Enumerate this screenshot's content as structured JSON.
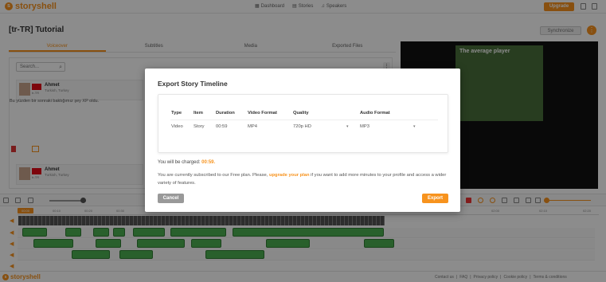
{
  "app": {
    "brand": "storyshell"
  },
  "nav": {
    "dashboard": "Dashboard",
    "stories": "Stories",
    "speakers": "Speakers"
  },
  "header": {
    "upgrade": "Upgrade",
    "title": "[tr-TR] Tutorial",
    "synchronize": "Synchronize",
    "more": "⋮"
  },
  "tabs": [
    "Voiceover",
    "Subtitles",
    "Media",
    "Exported Files"
  ],
  "search": {
    "placeholder": "Search..."
  },
  "segments": [
    {
      "name": "Ahmet",
      "lang": "Turkish, Turkey",
      "code": "tr-TR",
      "text": "Bu yüzden bir sonraki baktığımız şey XP oldu."
    },
    {
      "name": "Ahmet",
      "lang": "Turkish, Turkey",
      "code": "tr-TR"
    }
  ],
  "video": {
    "overlay_title": "The average player"
  },
  "timeline": {
    "playhead": "00:00",
    "ticks": [
      "00:10",
      "00:20",
      "00:30",
      "00:40",
      "00:50",
      "01:00",
      "01:10",
      "01:20",
      "01:30",
      "01:40",
      "01:50",
      "02:00",
      "02:10",
      "02:20"
    ]
  },
  "modal": {
    "title": "Export Story Timeline",
    "columns": [
      "Type",
      "Item",
      "Duration",
      "Video Format",
      "Quality",
      "Audio Format"
    ],
    "row": {
      "type": "Video",
      "item": "Story",
      "duration": "00:59",
      "video_format": "MP4",
      "quality": "720p HD",
      "audio_format": "MP3"
    },
    "charge_prefix": "You will be charged: ",
    "charge_value": "00:59.",
    "sub_prefix": "You are currently subscribed to our Free plan. Please, ",
    "sub_link": "upgrade your plan",
    "sub_suffix": " if you want to add more minutes to your profile and access a wider variety of features.",
    "cancel": "Cancel",
    "export": "Export"
  },
  "footer": {
    "links": [
      "Contact us",
      "|",
      "FAQ",
      "|",
      "Privacy policy",
      "|",
      "Cookie policy",
      "|",
      "Terms & conditions"
    ]
  },
  "colors": {
    "accent": "#f7931e",
    "clip": "#4caf50"
  }
}
